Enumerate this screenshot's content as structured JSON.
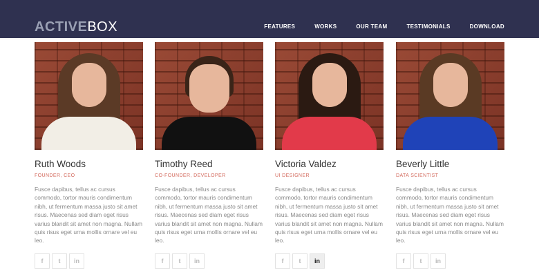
{
  "logo": {
    "part1": "ACTIVE",
    "part2": "BOX"
  },
  "nav": [
    "FEATURES",
    "WORKS",
    "OUR TEAM",
    "TESTIMONIALS",
    "DOWNLOAD"
  ],
  "team": [
    {
      "name": "Ruth Woods",
      "role": "FOUNDER, CEO",
      "bio": "Fusce dapibus, tellus ac cursus commodo, tortor mauris condimentum nibh, ut fermentum massa justo sit amet risus. Maecenas sed diam eget risus varius blandit sit amet non magna. Nullam quis risus eget urna mollis ornare vel eu leo."
    },
    {
      "name": "Timothy Reed",
      "role": "CO-FOUNDER, DEVELOPER",
      "bio": "Fusce dapibus, tellus ac cursus commodo, tortor mauris condimentum nibh, ut fermentum massa justo sit amet risus. Maecenas sed diam eget risus varius blandit sit amet non magna. Nullam quis risus eget urna mollis ornare vel eu leo."
    },
    {
      "name": "Victoria Valdez",
      "role": "UI DESIGNER",
      "bio": "Fusce dapibus, tellus ac cursus commodo, tortor mauris condimentum nibh, ut fermentum massa justo sit amet risus. Maecenas sed diam eget risus varius blandit sit amet non magna. Nullam quis risus eget urna mollis ornare vel eu leo."
    },
    {
      "name": "Beverly Little",
      "role": "DATA SCIENTIST",
      "bio": "Fusce dapibus, tellus ac cursus commodo, tortor mauris condimentum nibh, ut fermentum massa justo sit amet risus. Maecenas sed diam eget risus varius blandit sit amet non magna. Nullam quis risus eget urna mollis ornare vel eu leo."
    }
  ],
  "social_icons": [
    "facebook-icon",
    "twitter-icon",
    "linkedin-icon"
  ],
  "colors": {
    "header": "#2f3150",
    "accent": "#d36a5d",
    "active_icon_bg": "#eeeeee"
  }
}
